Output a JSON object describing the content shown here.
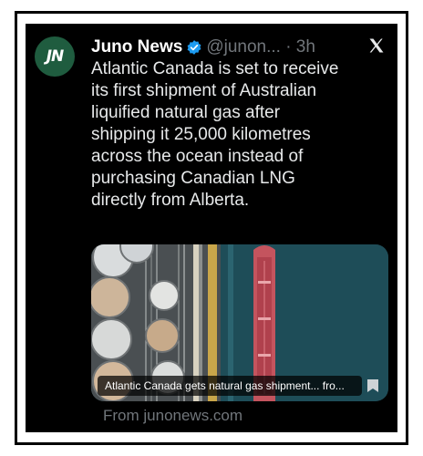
{
  "tweet": {
    "avatar_text": "JN",
    "author_name": "Juno News",
    "handle_time": "@junon... · 3h",
    "body": "Atlantic Canada is set to receive\nits first shipment of Australian\nliquified natural gas after\nshipping it 25,000 kilometres\nacross the ocean instead of\npurchasing Canadian LNG\ndirectly from Alberta.",
    "platform_icon": "x-logo-icon",
    "verified_icon": "verified-badge-icon",
    "verified_color": "#1d9bf0"
  },
  "card": {
    "caption": "Atlantic Canada gets natural gas shipment... fro...",
    "source": "From junonews.com",
    "bookmark_icon": "bookmark-icon"
  },
  "colors": {
    "background": "#000000",
    "avatar": "#1f5c3f",
    "text": "#e7e9ea",
    "secondary_text": "#71767b",
    "ship_hull": "#c4545e",
    "water": "#1e4d58"
  }
}
